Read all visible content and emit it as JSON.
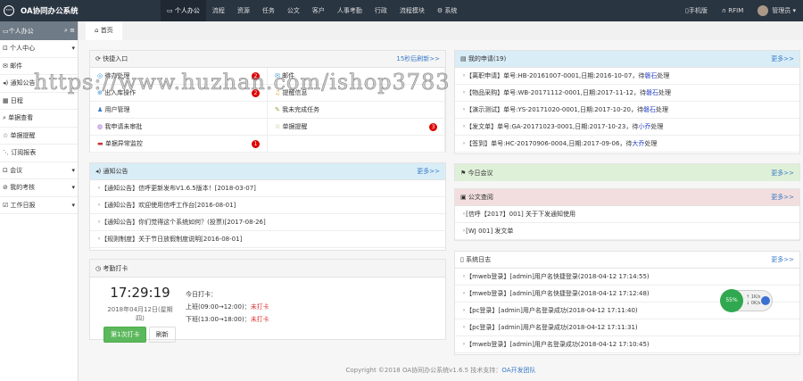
{
  "app": {
    "title": "OA协同办公系统"
  },
  "nav": [
    "个人办公",
    "流程",
    "资源",
    "任务",
    "公文",
    "客户",
    "人事考勤",
    "行政",
    "流程模块",
    "系统"
  ],
  "top_right": {
    "mobile": "手机版",
    "rfim": "RFIM",
    "user": "管理员"
  },
  "sidebar": {
    "title": "个人办公",
    "items": [
      "个人中心",
      "邮件",
      "通知公告",
      "日程",
      "单据查看",
      "单据提醒",
      "订阅报表",
      "会议",
      "我的考核",
      "工作日报"
    ]
  },
  "tab": "首页",
  "quick": {
    "title": "快捷入口",
    "link": "15秒后刷新>>",
    "items": [
      {
        "label": "待办处理",
        "badge": "2"
      },
      {
        "label": "邮件",
        "badge": ""
      },
      {
        "label": "出入库操作",
        "badge": "2"
      },
      {
        "label": "提醒信息",
        "badge": ""
      },
      {
        "label": "用户管理",
        "badge": ""
      },
      {
        "label": "我未完成任务",
        "badge": ""
      },
      {
        "label": "我申请未审批",
        "badge": ""
      },
      {
        "label": "单据提醒",
        "badge": "3"
      },
      {
        "label": "单据异常监控",
        "badge": "1"
      },
      {
        "label": "",
        "badge": ""
      }
    ]
  },
  "notice": {
    "title": "通知公告",
    "more": "更多>>",
    "items": [
      "【通知公告】信呼更新发布V1.6.5版本！[2018-03-07]",
      "【通知公告】欢迎使用信呼工作台[2016-08-01]",
      "【通知公告】你们觉得这个系统如何？(投票)[2017-08-26]",
      "【规则制度】关于节日放假制度说明[2016-08-01]"
    ]
  },
  "attendance": {
    "title": "考勤打卡",
    "time": "17:29:19",
    "date": "2018年04月12日(星期四)",
    "punch": "第1次打卡",
    "refresh": "刷新",
    "today": "今日打卡：",
    "am": "上班(09:00→12:00)：",
    "am_status": "未打卡",
    "pm": "下班(13:00→18:00)：",
    "pm_status": "未打卡"
  },
  "apply": {
    "title": "我的申请(19)",
    "more": "更多>>",
    "items": [
      {
        "text": "【离职申请】单号:HB-20161007-0001,日期:2016-10-07，待",
        "who": "磐石",
        "tail": "处理"
      },
      {
        "text": "【物品采购】单号:WB-20171112-0001,日期:2017-11-12，待",
        "who": "磐石",
        "tail": "处理"
      },
      {
        "text": "【演示测试】单号:YS-20171020-0001,日期:2017-10-20，待",
        "who": "磐石",
        "tail": "处理"
      },
      {
        "text": "【发文单】单号:GA-20171023-0001,日期:2017-10-23，待",
        "who": "小乔",
        "tail": "处理"
      },
      {
        "text": "【签到】单号:HC-20170906-0004,日期:2017-09-06，待",
        "who": "大乔",
        "tail": "处理"
      }
    ]
  },
  "meeting": {
    "title": "今日会议",
    "more": "更多>>"
  },
  "official": {
    "title": "公文查阅",
    "more": "更多>>",
    "items": [
      "[信呼【2017】001] 关于下发通知使用",
      "[WJ 001] 发文单"
    ]
  },
  "log": {
    "title": "系统日志",
    "more": "更多>>",
    "items": [
      "【mweb登录】[admin]用户名快捷登录(2018-04-12 17:14:55)",
      "【mweb登录】[admin]用户名快捷登录(2018-04-12 17:12:48)",
      "【pc登录】[admin]用户名登录成功(2018-04-12 17:11:40)",
      "【pc登录】[admin]用户名登录成功(2018-04-12 17:11:31)",
      "【mweb登录】[admin]用户名登录成功(2018-04-12 17:10:45)"
    ]
  },
  "footer": {
    "text": "Copyright ©2018  OA协同办公系统v1.6.5  技术支持：",
    "link": "OA开发团队"
  },
  "widget": {
    "percent": "55%",
    "up": "1K/s",
    "down": "0K/s"
  },
  "watermark": "https://www.huzhan.com/ishop3783"
}
